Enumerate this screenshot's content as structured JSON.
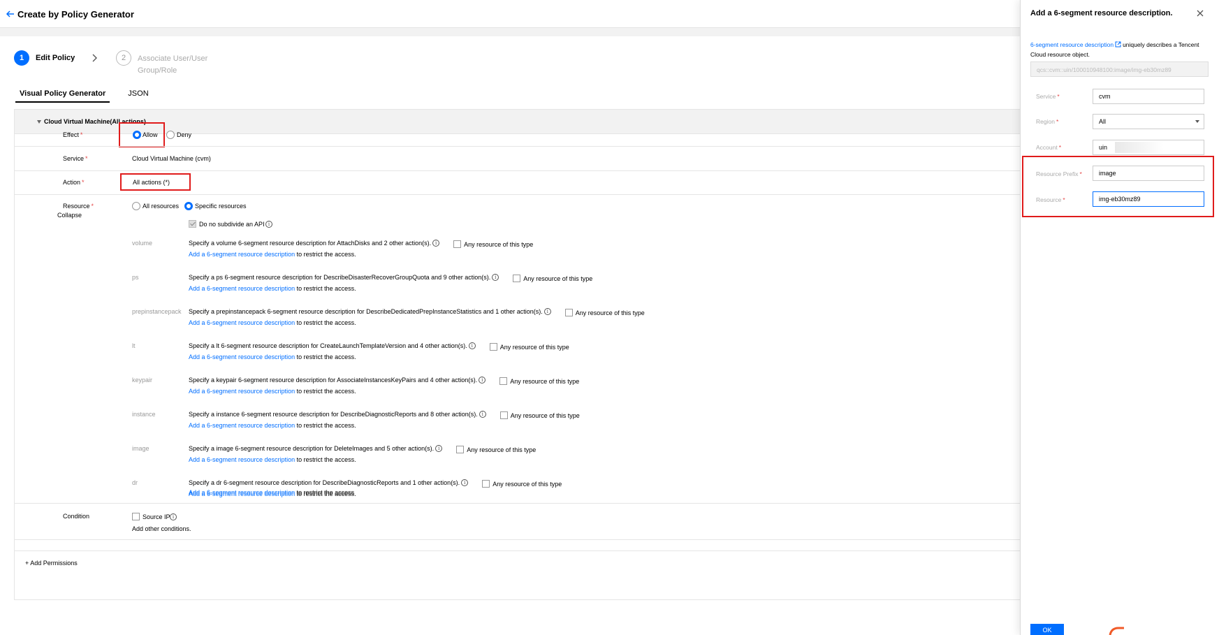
{
  "header": {
    "title": "Create by Policy Generator"
  },
  "steps": [
    {
      "number": "1",
      "label": "Edit Policy"
    },
    {
      "number": "2",
      "label": "Associate User/User Group/Role"
    }
  ],
  "tabs": [
    "Visual Policy Generator",
    "JSON"
  ],
  "section": {
    "title": "Cloud Virtual Machine(All actions)"
  },
  "effect": {
    "label": "Effect",
    "required": "*",
    "options": [
      "Allow",
      "Deny"
    ],
    "selected": "Allow"
  },
  "service": {
    "label": "Service",
    "required": "*",
    "value": "Cloud Virtual Machine (cvm)"
  },
  "action": {
    "label": "Action",
    "required": "*",
    "value": "All actions (*)"
  },
  "resource": {
    "label": "Resource",
    "required": "*",
    "collapse": "Collapse",
    "options": [
      "All resources",
      "Specific resources"
    ],
    "selected": "Specific resources",
    "no_subdivide": "Do no subdivide an API",
    "items": [
      {
        "type": "volume",
        "desc": "Specify a volume 6-segment resource description for AttachDisks and 2 other action(s).",
        "any": "Any resource of this type",
        "add_link": "Add a 6-segment resource description",
        "add_suffix": "to restrict the access."
      },
      {
        "type": "ps",
        "desc": "Specify a ps 6-segment resource description for DescribeDisasterRecoverGroupQuota and 9 other action(s).",
        "any": "Any resource of this type",
        "add_link": "Add a 6-segment resource description",
        "add_suffix": "to restrict the access."
      },
      {
        "type": "prepinstancepack",
        "desc": "Specify a prepinstancepack 6-segment resource description for DescribeDedicatedPrepInstanceStatistics and 1 other action(s).",
        "any": "Any resource of this type",
        "add_link": "Add a 6-segment resource description",
        "add_suffix": "to restrict the access."
      },
      {
        "type": "lt",
        "desc": "Specify a lt 6-segment resource description for CreateLaunchTemplateVersion and 4 other action(s).",
        "any": "Any resource of this type",
        "add_link": "Add a 6-segment resource description",
        "add_suffix": "to restrict the access."
      },
      {
        "type": "keypair",
        "desc": "Specify a keypair 6-segment resource description for AssociateInstancesKeyPairs and 4 other action(s).",
        "any": "Any resource of this type",
        "add_link": "Add a 6-segment resource description",
        "add_suffix": "to restrict the access."
      },
      {
        "type": "instance",
        "desc": "Specify a instance 6-segment resource description for DescribeDiagnosticReports and 8 other action(s).",
        "any": "Any resource of this type",
        "add_link": "Add a 6-segment resource description",
        "add_suffix": "to restrict the access."
      },
      {
        "type": "image",
        "desc": "Specify a image 6-segment resource description for DeleteImages and 5 other action(s).",
        "any": "Any resource of this type",
        "add_link": "Add a 6-segment resource description",
        "add_suffix": "to restrict the access."
      },
      {
        "type": "dr",
        "desc": "Specify a dr 6-segment resource description for DescribeDiagnosticReports and 1 other action(s).",
        "any": "Any resource of this type",
        "add_link": "Add a 6-segment resource description",
        "add_suffix": "to restrict the access."
      }
    ],
    "final_add_link": "Add a 6-segment resource description",
    "final_add_suffix": "to restrict the access"
  },
  "condition": {
    "label": "Condition",
    "source_ip": "Source IP",
    "add_other": "Add other conditions."
  },
  "add_permissions": "+ Add Permissions",
  "panel": {
    "title": "Add a 6-segment resource description.",
    "desc_link": "6-segment resource description",
    "desc_text": "uniquely describes a Tencent Cloud resource object.",
    "preview": "qcs::cvm::uin/100010948100:image/img-eb30mz89",
    "fields": {
      "service": {
        "label": "Service",
        "value": "cvm"
      },
      "region": {
        "label": "Region",
        "value": "All"
      },
      "account": {
        "label": "Account",
        "value": "uin"
      },
      "resource_prefix": {
        "label": "Resource Prefix",
        "value": "image"
      },
      "resource": {
        "label": "Resource",
        "value": "img-eb30mz89"
      }
    },
    "required": "*",
    "ok": "OK"
  },
  "colors": {
    "accent": "#006eff",
    "highlight": "#e01b1b",
    "required": "#e54545"
  }
}
